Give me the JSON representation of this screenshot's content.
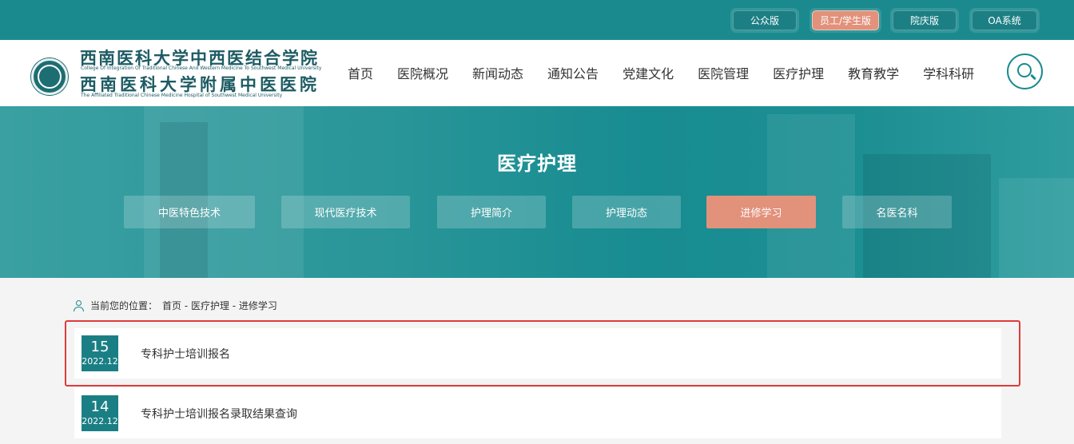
{
  "top_links": [
    {
      "label": "公众版",
      "active": false
    },
    {
      "label": "员工/学生版",
      "active": true
    },
    {
      "label": "院庆版",
      "active": false
    },
    {
      "label": "OA系统",
      "active": false
    }
  ],
  "logo": {
    "name_line1": "西南医科大学中西医结合学院",
    "name_line1_en": "College Of Integration Of Traditional Chinese And Western Medicine To Southwest Medical University",
    "name_line2": "西南医科大学附属中医医院",
    "name_line2_en": "The Affiliated Traditional Chinese Medicine Hospital of Southwest Medical University"
  },
  "nav": [
    "首页",
    "医院概况",
    "新闻动态",
    "通知公告",
    "党建文化",
    "医院管理",
    "医疗护理",
    "教育教学",
    "学科科研"
  ],
  "banner": {
    "title": "医疗护理",
    "subnav": [
      "中医特色技术",
      "现代医疗技术",
      "护理简介",
      "护理动态",
      "进修学习",
      "名医名科"
    ],
    "active_index": 4
  },
  "breadcrumb": {
    "prefix": "当前您的位置：",
    "path": "首页 - 医疗护理 - 进修学习"
  },
  "news": [
    {
      "day": "15",
      "ym": "2022.12",
      "title": "专科护士培训报名"
    },
    {
      "day": "14",
      "ym": "2022.12",
      "title": "专科护士培训报名录取结果查询"
    }
  ],
  "colors": {
    "primary": "#1a8a8e",
    "accent": "#e2917b",
    "highlight": "#e03a3a"
  }
}
